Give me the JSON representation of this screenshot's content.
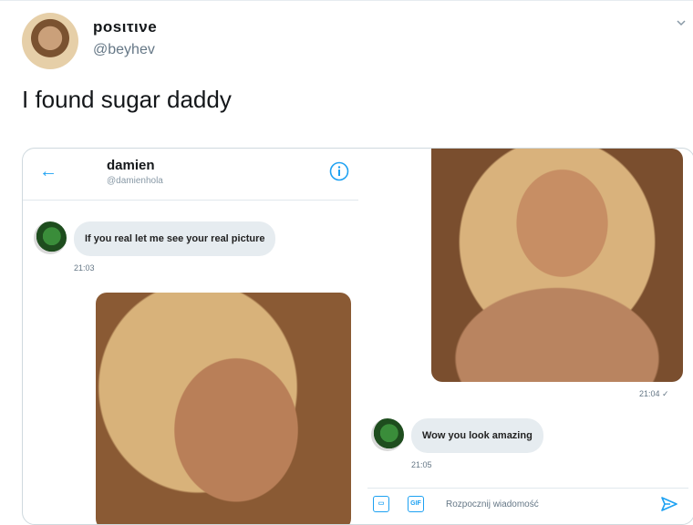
{
  "tweet": {
    "display_name": "posιτινe",
    "handle": "@beyhev",
    "text": "I found sugar daddy"
  },
  "dm": {
    "contact_name": "damien",
    "contact_handle": "@damienhola",
    "messages": [
      {
        "text": "If you real let me see your real picture",
        "time": "21:03"
      },
      {
        "time": "21:04 ✓"
      },
      {
        "text": "Wow you look amazing",
        "time": "21:05"
      }
    ],
    "compose_placeholder": "Rozpocznij wiadomość",
    "gif_label": "GIF"
  },
  "icons": {
    "back": "arrow-left-icon",
    "info": "info-icon",
    "image": "image-icon",
    "gif": "gif-icon",
    "send": "send-icon",
    "more": "chevron-down-icon"
  },
  "colors": {
    "accent": "#1da1f2",
    "bubble": "#e6ecf0",
    "muted": "#657786"
  }
}
